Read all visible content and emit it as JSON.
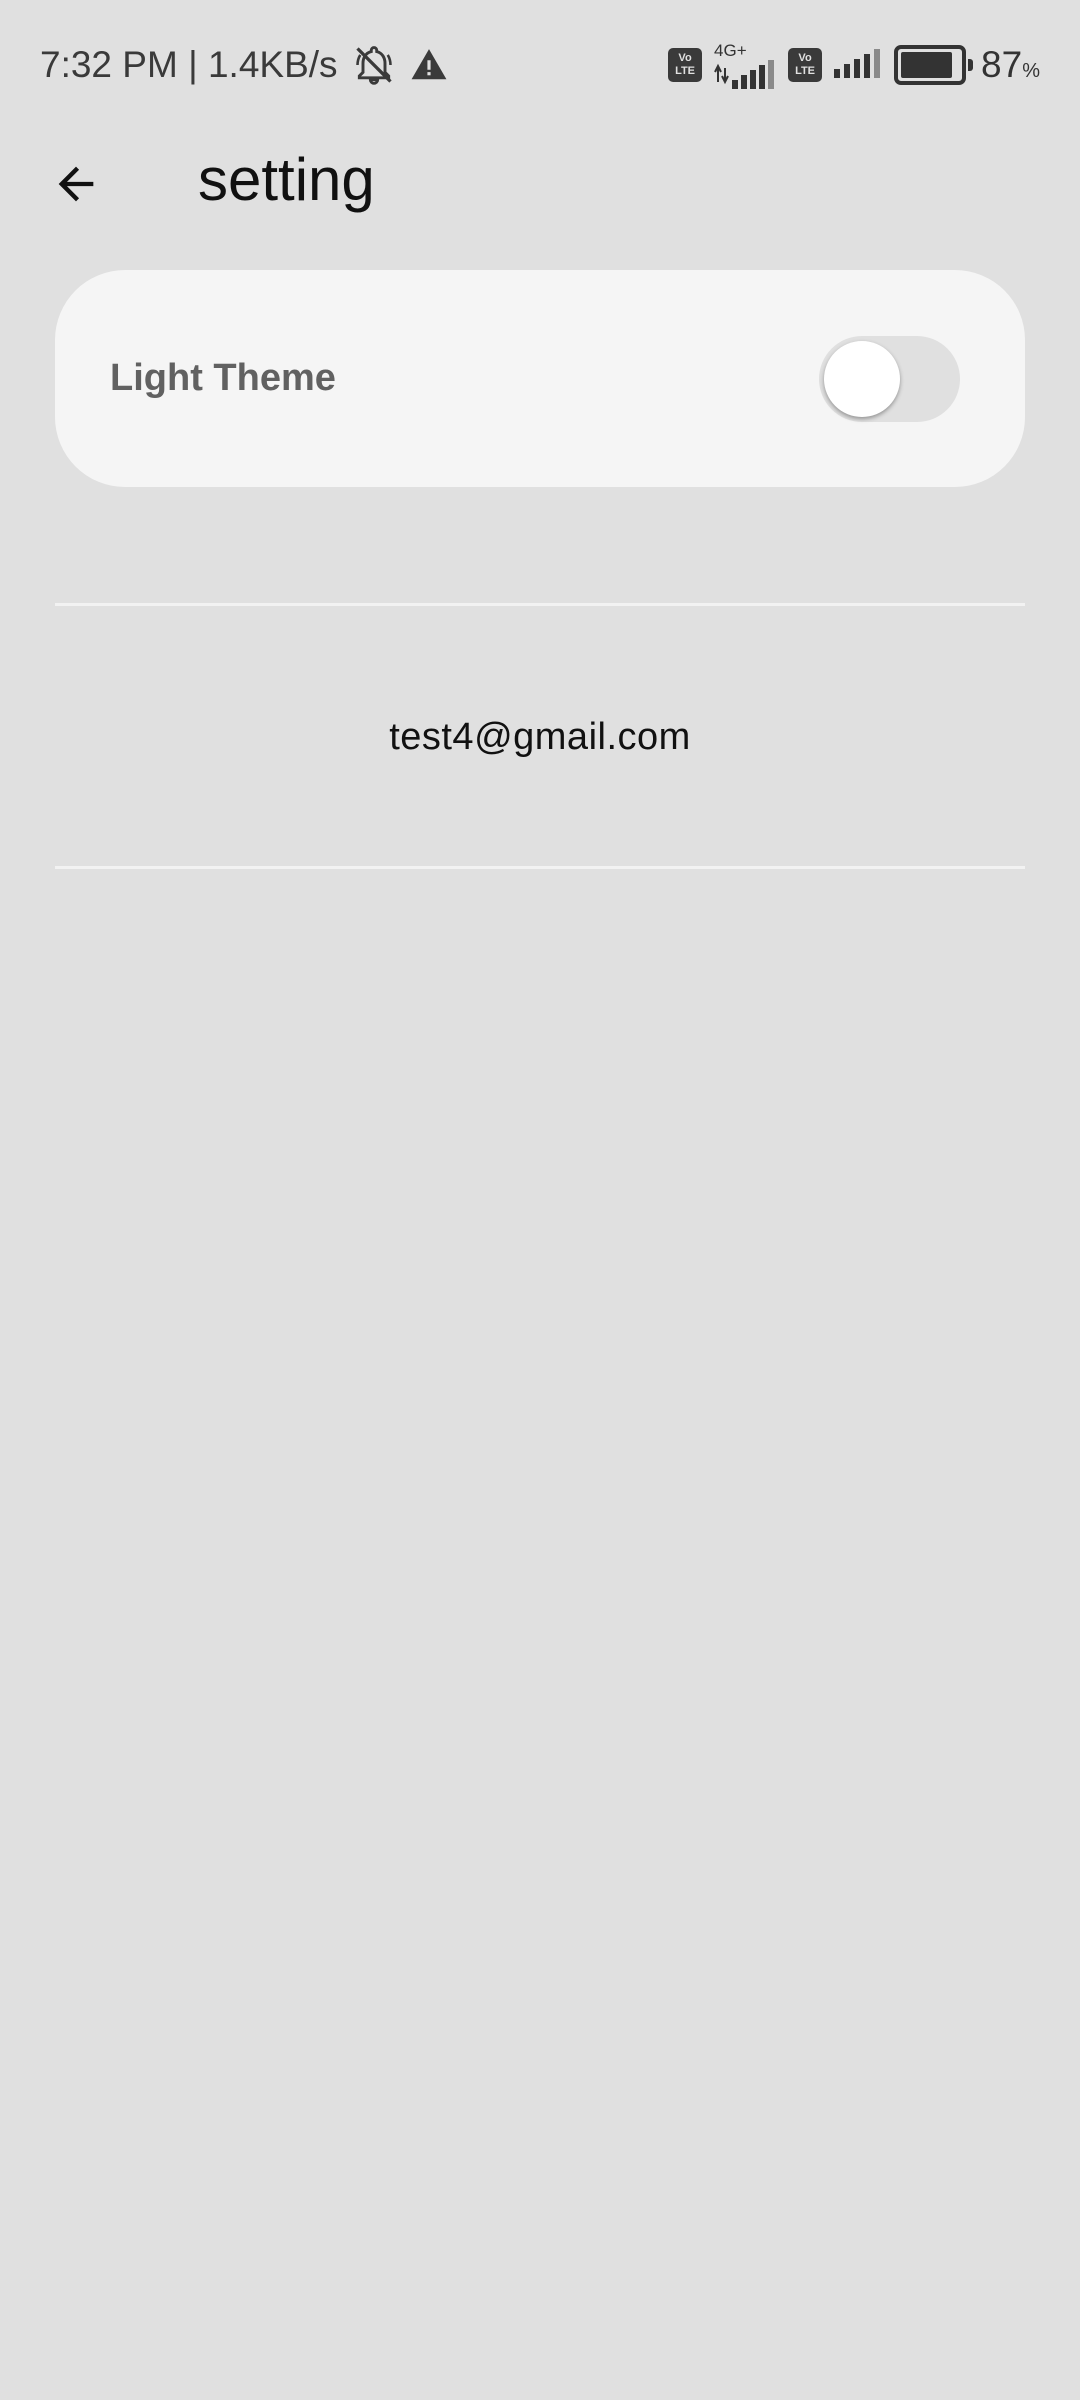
{
  "status_bar": {
    "time_speed": "7:32 PM | 1.4KB/s",
    "icons": [
      "notifications-off-icon",
      "warning-icon",
      "volte-icon",
      "signal-icon",
      "volte-icon",
      "signal-icon",
      "battery-icon"
    ],
    "volte_top": "Vo",
    "volte_bottom": "LTE",
    "network_type": "4G+",
    "battery_level": 0.87,
    "battery_value": "87",
    "battery_unit": "%"
  },
  "app_bar": {
    "back_icon": "arrow-back-icon",
    "title": "setting"
  },
  "theme_setting": {
    "label": "Light Theme",
    "toggle_on": false
  },
  "account": {
    "email": "test4@gmail.com"
  },
  "colors": {
    "background": "#e0e0e0",
    "card": "#f5f5f5",
    "label_text": "#616161",
    "divider": "#f2f2f2"
  }
}
